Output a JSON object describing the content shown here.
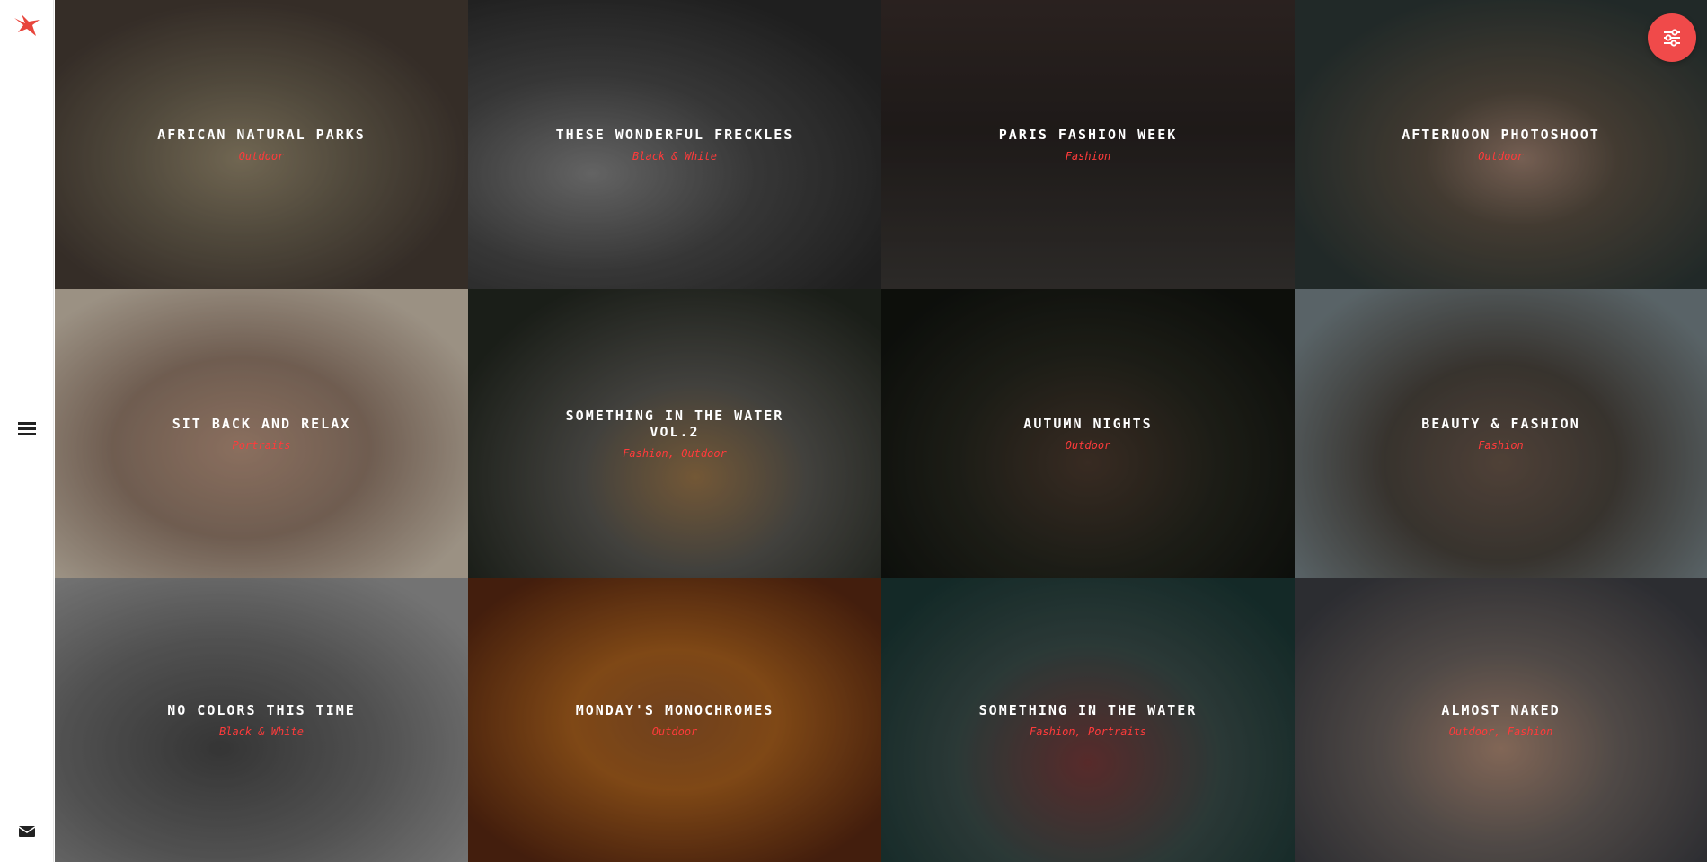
{
  "sidebar": {
    "logo_icon": "bird-logo-icon",
    "menu_icon": "hamburger-icon",
    "mail_icon": "mail-icon"
  },
  "filter_button": {
    "icon": "sliders-icon",
    "color": "#f04a4a"
  },
  "accent_color": "#ff3b3b",
  "gallery": [
    {
      "title": "AFRICAN NATURAL PARKS",
      "tags": "Outdoor"
    },
    {
      "title": "THESE WONDERFUL FRECKLES",
      "tags": "Black & White"
    },
    {
      "title": "PARIS FASHION WEEK",
      "tags": "Fashion"
    },
    {
      "title": "AFTERNOON PHOTOSHOOT",
      "tags": "Outdoor"
    },
    {
      "title": "SIT BACK AND RELAX",
      "tags": "Portraits"
    },
    {
      "title": "SOMETHING IN THE WATER VOL.2",
      "tags": "Fashion, Outdoor"
    },
    {
      "title": "AUTUMN NIGHTS",
      "tags": "Outdoor"
    },
    {
      "title": "BEAUTY & FASHION",
      "tags": "Fashion"
    },
    {
      "title": "NO COLORS THIS TIME",
      "tags": "Black & White"
    },
    {
      "title": "MONDAY'S MONOCHROMES",
      "tags": "Outdoor"
    },
    {
      "title": "SOMETHING IN THE WATER",
      "tags": "Fashion, Portraits"
    },
    {
      "title": "ALMOST NAKED",
      "tags": "Outdoor, Fashion"
    }
  ]
}
